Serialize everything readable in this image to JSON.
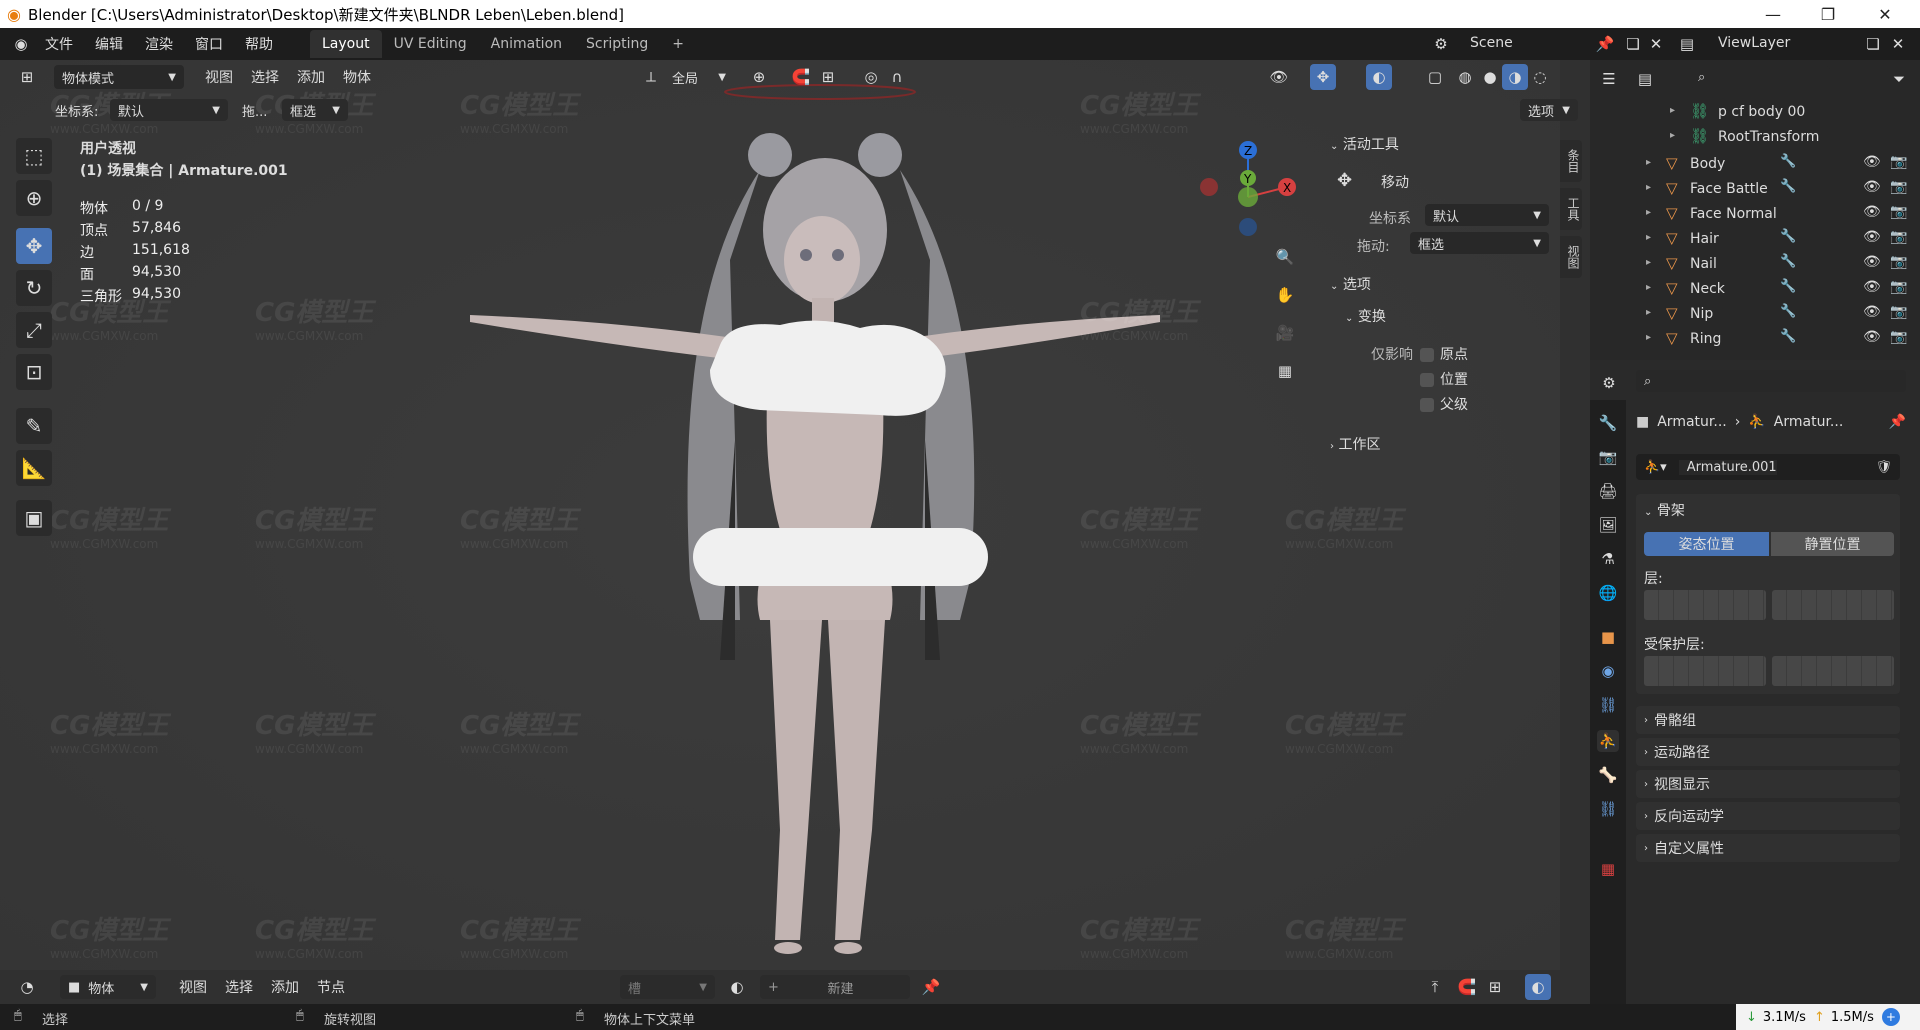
{
  "window": {
    "title": "Blender [C:\\Users\\Administrator\\Desktop\\新建文件夹\\BLNDR Leben\\Leben.blend]"
  },
  "menu": [
    "文件",
    "编辑",
    "渲染",
    "窗口",
    "帮助"
  ],
  "workspaces": [
    "Layout",
    "UV Editing",
    "Animation",
    "Scripting"
  ],
  "scene": {
    "label": "Scene",
    "viewlayer": "ViewLayer"
  },
  "viewport_header": {
    "mode": "物体模式",
    "menus": [
      "视图",
      "选择",
      "添加",
      "物体"
    ],
    "transform_orientation": "全局",
    "options_btn": "选项"
  },
  "tool_settings": {
    "coord_label": "坐标系:",
    "coord_value": "默认",
    "drag_label": "拖...",
    "drag_value": "框选"
  },
  "overlay": {
    "view_name": "用户透视",
    "collection": "(1) 场景集合 | Armature.001",
    "stats": [
      {
        "label": "物体",
        "value": "0 / 9"
      },
      {
        "label": "顶点",
        "value": "57,846"
      },
      {
        "label": "边",
        "value": "151,618"
      },
      {
        "label": "面",
        "value": "94,530"
      },
      {
        "label": "三角形",
        "value": "94,530"
      }
    ]
  },
  "npanel": {
    "active_tool_header": "活动工具",
    "tool_name": "移动",
    "coord_label": "坐标系",
    "coord_value": "默认",
    "drag_label": "拖动:",
    "drag_value": "框选",
    "options_header": "选项",
    "transform_header": "变换",
    "affect_only_label": "仅影响",
    "affect_items": [
      "原点",
      "位置",
      "父级"
    ],
    "workspace_header": "工作区",
    "tabs": [
      "条目",
      "工具",
      "视图"
    ]
  },
  "gizmo": {
    "z": "Z",
    "y": "Y",
    "x": "X"
  },
  "outliner": {
    "items": [
      {
        "name": "p cf body 00",
        "type": "armature"
      },
      {
        "name": "RootTransform",
        "type": "armature"
      },
      {
        "name": "Body",
        "type": "mesh"
      },
      {
        "name": "Face Battle",
        "type": "mesh"
      },
      {
        "name": "Face Normal",
        "type": "mesh"
      },
      {
        "name": "Hair",
        "type": "mesh"
      },
      {
        "name": "Nail",
        "type": "mesh"
      },
      {
        "name": "Neck",
        "type": "mesh"
      },
      {
        "name": "Nip",
        "type": "mesh"
      },
      {
        "name": "Ring",
        "type": "mesh"
      }
    ]
  },
  "properties": {
    "breadcrumb": [
      "Armatur...",
      "Armatur..."
    ],
    "datablock": "Armature.001",
    "skeleton_header": "骨架",
    "pose_btn": "姿态位置",
    "rest_btn": "静置位置",
    "layers_label": "层:",
    "protected_label": "受保护层:",
    "sections": [
      "骨骼组",
      "运动路径",
      "视图显示",
      "反向运动学",
      "自定义属性"
    ]
  },
  "timeline": {
    "mode": "物体",
    "menus": [
      "视图",
      "选择",
      "添加",
      "节点"
    ],
    "slot_label": "槽",
    "new_btn": "新建"
  },
  "statusbar": {
    "select": "选择",
    "rotate": "旋转视图",
    "context": "物体上下文菜单",
    "down": "3.1M/s",
    "up": "1.5M/s"
  },
  "watermark": {
    "text": "CG模型王",
    "url": "www.CGMXW.com"
  },
  "colors": {
    "accent": "#4772b3",
    "orange": "#e8954a",
    "bg": "#393939"
  }
}
